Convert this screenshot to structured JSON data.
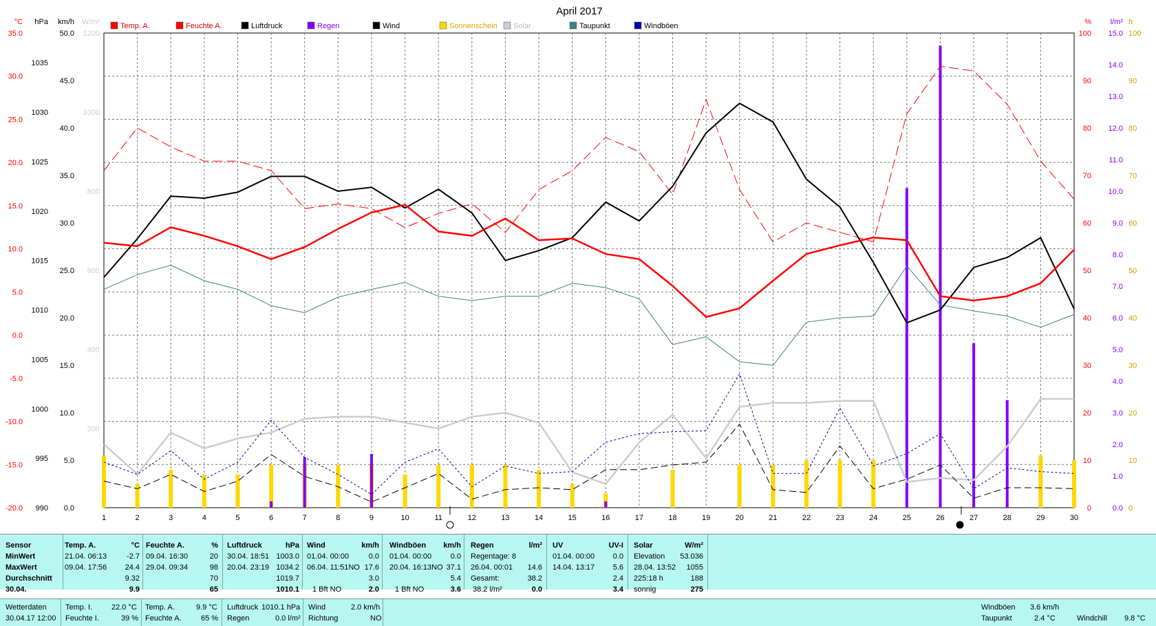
{
  "title": "April 2017",
  "axes": {
    "temp": {
      "unit": "°C",
      "ticks": [
        "35.0",
        "30.0",
        "25.0",
        "20.0",
        "15.0",
        "10.0",
        "5.0",
        "0.0",
        "-5.0",
        "-10.0",
        "-15.0",
        "-20.0"
      ],
      "range": [
        -20,
        35
      ]
    },
    "pressure": {
      "unit": "hPa",
      "ticks": [
        "1035",
        "1030",
        "1025",
        "1020",
        "1015",
        "1010",
        "1005",
        "1000",
        "995",
        "990"
      ],
      "range": [
        990,
        1038
      ]
    },
    "wind": {
      "unit": "km/h",
      "ticks": [
        "50.0",
        "45.0",
        "40.0",
        "35.0",
        "30.0",
        "25.0",
        "20.0",
        "15.0",
        "10.0",
        "5.0",
        "0.0"
      ],
      "range": [
        0,
        50
      ]
    },
    "solar": {
      "unit": "W/m²",
      "ticks": [
        "1200",
        "1000",
        "800",
        "600",
        "400",
        "200"
      ],
      "range": [
        0,
        1200
      ]
    },
    "humidity": {
      "unit": "%",
      "ticks": [
        "100",
        "90",
        "80",
        "70",
        "60",
        "50",
        "40",
        "30",
        "20",
        "10",
        "0"
      ],
      "range": [
        0,
        100
      ]
    },
    "rain": {
      "unit": "l/m²",
      "ticks": [
        "15.0",
        "14.0",
        "13.0",
        "12.0",
        "11.0",
        "10.0",
        "9.0",
        "8.0",
        "7.0",
        "6.0",
        "5.0",
        "4.0",
        "3.0",
        "2.0",
        "1.0",
        "0.0"
      ],
      "range": [
        0,
        15
      ]
    },
    "sun": {
      "unit": "h",
      "ticks": [
        "100",
        "90",
        "80",
        "70",
        "60",
        "50",
        "40",
        "30",
        "20",
        "10",
        "0"
      ],
      "range": [
        0,
        100
      ]
    },
    "days": [
      "1",
      "2",
      "3",
      "4",
      "5",
      "6",
      "7",
      "8",
      "9",
      "10",
      "11",
      "12",
      "13",
      "14",
      "15",
      "16",
      "17",
      "18",
      "19",
      "20",
      "21",
      "22",
      "23",
      "24",
      "25",
      "26",
      "27",
      "28",
      "29",
      "30"
    ]
  },
  "colors": {
    "temp": "#ff0000",
    "humidity": "#ff0000",
    "pressure": "#000000",
    "rain": "#8000ff",
    "wind": "#000000",
    "sun": "#ffd700",
    "solar": "#cccccc",
    "dew": "#408080",
    "gust": "#0000aa",
    "axis_temp": "#ff0000",
    "axis_rain": "#8000ff",
    "axis_sun": "#c8a000"
  },
  "legend": [
    {
      "label": "Temp. A.",
      "color": "#ff0000"
    },
    {
      "label": "Feuchte A.",
      "color": "#ff0000"
    },
    {
      "label": "Luftdruck",
      "color": "#000000"
    },
    {
      "label": "Regen",
      "color": "#8000ff"
    },
    {
      "label": "Wind",
      "color": "#000000"
    },
    {
      "label": "Sonnenschein",
      "color": "#ffd700"
    },
    {
      "label": "Solar",
      "color": "#cccccc"
    },
    {
      "label": "Taupunkt",
      "color": "#408080"
    },
    {
      "label": "Windböen",
      "color": "#0000aa"
    }
  ],
  "chart_data": {
    "type": "line",
    "x": [
      1,
      2,
      3,
      4,
      5,
      6,
      7,
      8,
      9,
      10,
      11,
      12,
      13,
      14,
      15,
      16,
      17,
      18,
      19,
      20,
      21,
      22,
      23,
      24,
      25,
      26,
      27,
      28,
      29,
      30
    ],
    "series": [
      {
        "name": "Temp. A.",
        "axis": "temp",
        "values": [
          10.7,
          10.3,
          12.5,
          11.5,
          10.3,
          8.8,
          10.2,
          12.3,
          14.2,
          15.1,
          12.0,
          11.5,
          13.5,
          11.0,
          11.2,
          9.4,
          8.8,
          5.7,
          2.1,
          3.1,
          6.3,
          9.4,
          10.4,
          11.3,
          11.0,
          4.5,
          4.0,
          4.5,
          6.0,
          9.9
        ]
      },
      {
        "name": "Feuchte A.",
        "axis": "humidity",
        "values": [
          71,
          80,
          76,
          73,
          73,
          71,
          63,
          64,
          63,
          59,
          62,
          64,
          58,
          67,
          71,
          78,
          75,
          66,
          86,
          67,
          56,
          60,
          58,
          56,
          83,
          93,
          92,
          85,
          73,
          65
        ]
      },
      {
        "name": "Luftdruck",
        "axis": "pressure",
        "values": [
          1013.3,
          1017.2,
          1021.5,
          1021.3,
          1021.9,
          1023.5,
          1023.5,
          1022.0,
          1022.4,
          1020.3,
          1022.2,
          1019.8,
          1015.0,
          1016.0,
          1017.3,
          1020.9,
          1019.0,
          1022.5,
          1027.9,
          1030.9,
          1029.0,
          1023.2,
          1020.4,
          1014.8,
          1008.7,
          1010.0,
          1014.3,
          1015.3,
          1017.3,
          1010.1
        ]
      },
      {
        "name": "Wind",
        "axis": "wind",
        "values": [
          2.8,
          2.0,
          3.5,
          1.7,
          2.8,
          5.6,
          3.3,
          2.2,
          0.6,
          2.1,
          3.6,
          0.9,
          1.9,
          2.1,
          1.9,
          4.0,
          4.0,
          4.5,
          4.8,
          8.8,
          1.9,
          1.6,
          6.5,
          2.0,
          3.0,
          4.5,
          1.0,
          2.1,
          2.1,
          2.0
        ]
      },
      {
        "name": "Windböen",
        "axis": "wind",
        "values": [
          4.8,
          3.5,
          6.0,
          3.0,
          4.8,
          9.2,
          5.3,
          3.5,
          1.4,
          4.8,
          6.2,
          2.2,
          4.4,
          3.6,
          3.8,
          6.9,
          7.8,
          8.0,
          8.1,
          14.1,
          3.6,
          3.6,
          10.5,
          4.4,
          5.7,
          7.8,
          2.0,
          4.2,
          3.8,
          3.6
        ]
      },
      {
        "name": "Taupunkt",
        "axis": "temp",
        "values": [
          5.3,
          7.0,
          8.1,
          6.3,
          5.3,
          3.4,
          2.6,
          4.4,
          5.3,
          6.1,
          4.5,
          4.0,
          4.5,
          4.5,
          6.0,
          5.5,
          4.2,
          -1.1,
          -0.2,
          -3.1,
          -3.5,
          1.5,
          2.0,
          2.2,
          8.0,
          3.5,
          2.8,
          2.2,
          0.9,
          2.4
        ]
      },
      {
        "name": "Solar",
        "axis": "solar",
        "values": [
          160,
          85,
          190,
          150,
          175,
          190,
          225,
          230,
          230,
          215,
          200,
          230,
          240,
          215,
          90,
          60,
          165,
          235,
          125,
          255,
          265,
          265,
          270,
          270,
          65,
          75,
          70,
          155,
          275,
          275
        ]
      },
      {
        "name": "Regen",
        "axis": "rain",
        "type": "bar",
        "values": [
          0,
          0,
          0,
          0,
          0,
          0.2,
          1.6,
          0,
          1.7,
          0,
          0,
          0,
          0,
          0,
          0,
          0.2,
          0,
          0,
          0,
          0,
          0,
          0,
          0,
          0,
          10.1,
          14.6,
          5.2,
          3.4,
          0,
          0
        ]
      },
      {
        "name": "Sonnenschein",
        "axis": "sun",
        "type": "bar",
        "values": [
          11,
          5,
          8,
          7,
          7,
          9,
          9,
          9,
          9,
          7,
          9,
          9,
          9,
          8,
          5,
          3,
          0,
          8,
          0,
          9,
          9,
          10,
          10,
          10,
          0,
          0,
          0,
          0,
          11,
          10
        ]
      }
    ]
  },
  "table": {
    "sensor": {
      "h": "Sensor",
      "min": "MinWert",
      "max": "MaxWert",
      "avg": "Durchschnitt",
      "cur": "30.04."
    },
    "temp": {
      "h": "Temp. A.",
      "u": "°C",
      "min_t": "21.04.  06:13",
      "min_v": "-2.7",
      "max_t": "09.04.  17:56",
      "max_v": "24.4",
      "avg": "9.32",
      "cur": "9.9"
    },
    "hum": {
      "h": "Feuchte A.",
      "u": "%",
      "min_t": "09.04.  16:30",
      "min_v": "20",
      "max_t": "29.04.  09:34",
      "max_v": "98",
      "avg": "70",
      "cur": "65"
    },
    "press": {
      "h": "Luftdruck",
      "u": "hPa",
      "min_t": "30.04.  18:51",
      "min_v": "1003.0",
      "max_t": "20.04.  23:19",
      "max_v": "1034.2",
      "avg": "1019.7",
      "cur": "1010.1"
    },
    "wind": {
      "h": "Wind",
      "u": "km/h",
      "min_t": "01.04.  00:00",
      "min_v": "0.0",
      "max_t": "06.04.  11:51NO",
      "max_v": "17.6",
      "avg": "3.0",
      "cur_l": "1 Bft NO",
      "cur": "2.0"
    },
    "gust": {
      "h": "Windböen",
      "u": "km/h",
      "min_t": "01.04.  00:00",
      "min_v": "0.0",
      "max_t": "20.04.  16:13NO",
      "max_v": "37.1",
      "avg": "5.4",
      "cur_l": "1 Bft NO",
      "cur": "3.6"
    },
    "rain": {
      "h": "Regen",
      "u": "l/m²",
      "min_l": "Regentage: 8",
      "max_t": "26.04.  00:01",
      "max_v": "14.6",
      "avg_l": "Gesamt:",
      "avg": "38.2",
      "cur_l": "38.2 l/m²",
      "cur": "0.0"
    },
    "uv": {
      "h": "UV",
      "u": "UV-I",
      "min_t": "01.04.  00:00",
      "min_v": "0.0",
      "max_t": "14.04.  13:17",
      "max_v": "5.6",
      "avg": "2.4",
      "cur": "3.4"
    },
    "solar": {
      "h": "Solar",
      "u": "W/m²",
      "min_l": "Elevation",
      "min_v": "53.036",
      "max_t": "28.04.  13:52",
      "max_v": "1055",
      "avg_l": "225:18 h",
      "avg": "188",
      "cur_l": "sonnig",
      "cur": "275"
    }
  },
  "bottom": {
    "wd_l": "Wetterdaten",
    "wd_v": "30.04.17 12:00",
    "ti_l": "Temp. I.",
    "ti_v": "22.0 °C",
    "fi_l": "Feuchte I.",
    "fi_v": "39 %",
    "ta_l": "Temp. A.",
    "ta_v": "9.9 °C",
    "fa_l": "Feuchte A.",
    "fa_v": "65 %",
    "lp_l": "Luftdruck",
    "lp_v": "1010.1 hPa",
    "rg_l": "Regen",
    "rg_v": "0.0 l/m²",
    "wi_l": "Wind",
    "wi_v": "2.0 km/h",
    "ri_l": "Richtung",
    "ri_v": "NO",
    "wb_l": "Windböen",
    "wb_v": "3.6 km/h",
    "tp_l": "Taupunkt",
    "tp_v": "2.4 °C",
    "wc_l": "Windchill",
    "wc_v": "9.8 °C"
  }
}
